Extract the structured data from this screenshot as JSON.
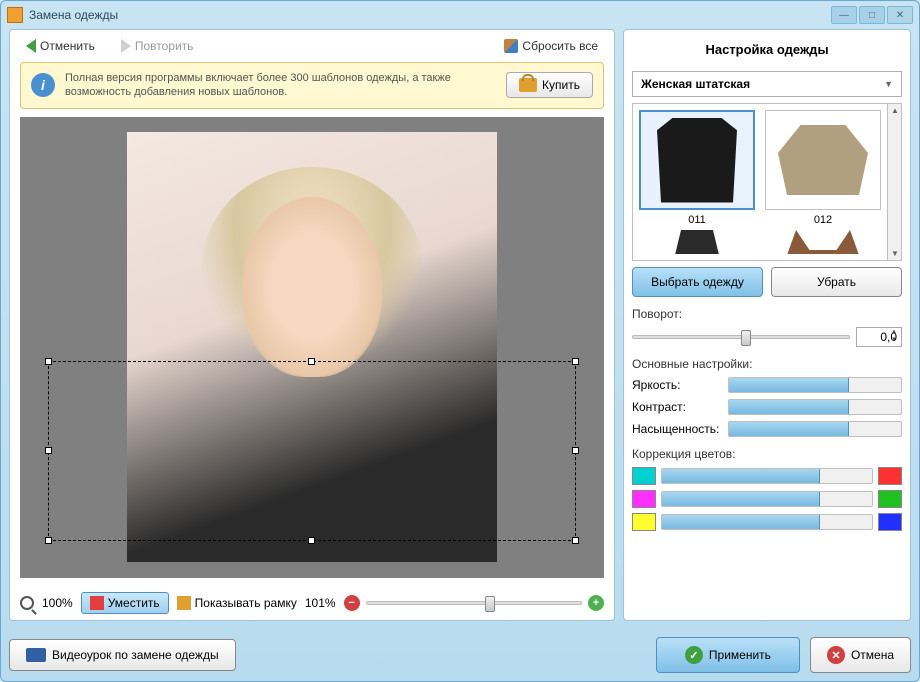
{
  "window": {
    "title": "Замена одежды"
  },
  "toolbar": {
    "undo": "Отменить",
    "redo": "Повторить",
    "reset": "Сбросить все"
  },
  "info": {
    "text": "Полная версия программы включает более 300 шаблонов одежды, а также возможность добавления новых шаблонов.",
    "buy": "Купить"
  },
  "bottom": {
    "zoom_label": "100%",
    "fit": "Уместить",
    "show_frame": "Показывать рамку",
    "zoom_value": "101%"
  },
  "right": {
    "title": "Настройка одежды",
    "category": "Женская штатская",
    "thumbs": {
      "a": "011",
      "b": "012"
    },
    "select_btn": "Выбрать одежду",
    "remove_btn": "Убрать",
    "rotation_label": "Поворот:",
    "rotation_value": "0,0",
    "main_settings": "Основные настройки:",
    "brightness": "Яркость:",
    "contrast": "Контраст:",
    "saturation": "Насыщенность:",
    "color_corr": "Коррекция цветов:",
    "colors": {
      "c1a": "#00d0d0",
      "c1b": "#ff3030",
      "c2a": "#ff30ff",
      "c2b": "#20c020",
      "c3a": "#ffff30",
      "c3b": "#2030ff"
    }
  },
  "footer": {
    "tutorial": "Видеоурок по замене одежды",
    "apply": "Применить",
    "cancel": "Отмена"
  }
}
